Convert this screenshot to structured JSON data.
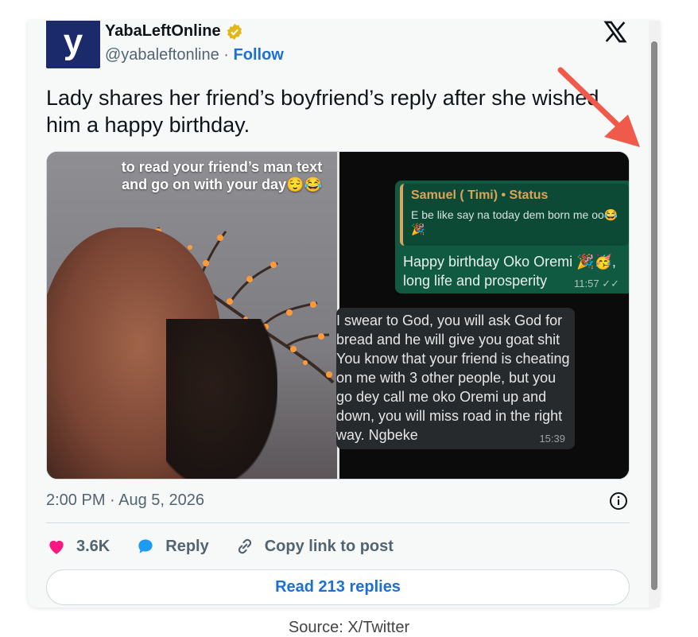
{
  "tweet": {
    "author_name": "YabaLeftOnline",
    "handle": "@yabaleftonline",
    "separator": " · ",
    "follow_label": "Follow",
    "avatar_letter": "y",
    "text": "Lady shares her friend’s boyfriend’s reply after she wished him a happy birthday.",
    "timestamp": "2:00 PM · Aug 5, 2026",
    "likes": "3.6K",
    "reply_label": "Reply",
    "copy_link_label": "Copy link to post",
    "read_replies_label": "Read 213 replies"
  },
  "media": {
    "left_caption": "to read your friend’s man text and go on with your day😌😂",
    "quote_name": "Samuel ( Timi) • Status",
    "quote_text": "E be like say na today dem born me oo😂🎉",
    "outgoing_message": "Happy birthday Oko Oremi 🎉🥳, long life and prosperity",
    "outgoing_time": "11:57 ✓✓",
    "incoming_message": "I swear to God, you will ask God for bread and he will give you goat shit You know that your friend is cheating on me with 3 other people, but you go dey call me oko Oremi up and down, you will miss road in the right way. Ngbeke",
    "incoming_time": "15:39"
  },
  "footer_text": "Source: X/Twitter",
  "colors": {
    "link_blue": "#1d6fd3",
    "like_pink": "#f91880",
    "reply_blue": "#1d9bf0",
    "badge_gold": "#e2b719",
    "arrow_red": "#f05a4a"
  },
  "icons": [
    "verified-badge-icon",
    "x-logo-icon",
    "info-icon",
    "heart-icon",
    "reply-bubble-icon",
    "link-icon",
    "red-arrow-annotation"
  ]
}
